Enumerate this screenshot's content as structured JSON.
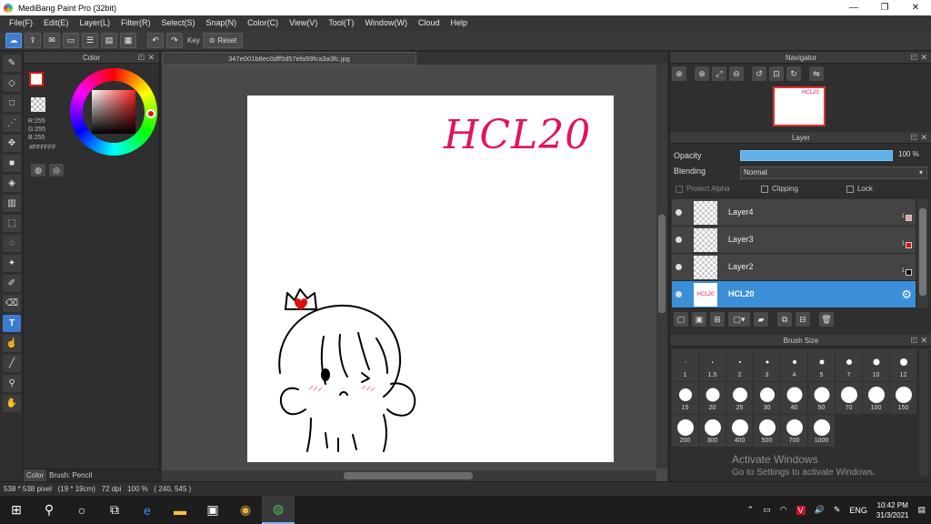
{
  "window": {
    "title": "MediBang Paint Pro (32bit)",
    "minimize": "—",
    "maximize": "❐",
    "close": "✕"
  },
  "menu": [
    "File(F)",
    "Edit(E)",
    "Layer(L)",
    "Filter(R)",
    "Select(S)",
    "Snap(N)",
    "Color(C)",
    "View(V)",
    "Tool(T)",
    "Window(W)",
    "Cloud",
    "Help"
  ],
  "toolbar": {
    "key_label": "Key",
    "reset_label": "Reset"
  },
  "color_panel": {
    "title": "Color",
    "rgb": "R:255\nG:255\nB:255",
    "hex": "#FFFFFF",
    "fg_color": "#ffffff",
    "tabs": {
      "color": "Color",
      "brush": "Brush: Pencil"
    }
  },
  "document": {
    "tab_title": "347e001b8ec0dff5d57efa59fca3a3fc.jpg",
    "canvas_text": "HCL20",
    "canvas_text_color": "#e4135a"
  },
  "navigator": {
    "title": "Navigator",
    "thumb_text": "HCL20"
  },
  "layer_panel": {
    "title": "Layer",
    "opacity_label": "Opacity",
    "opacity_value": "100 %",
    "opacity_fraction": 1.0,
    "blending_label": "Blending",
    "blending_value": "Normal",
    "protect_alpha": "Protect Alpha",
    "clipping": "Clipping",
    "lock": "Lock",
    "layers": [
      {
        "name": "Layer4",
        "count": "1",
        "color": "#f4a0a0"
      },
      {
        "name": "Layer3",
        "count": "1",
        "color": "#e01010"
      },
      {
        "name": "Layer2",
        "count": "1",
        "color": "#000000"
      },
      {
        "name": "HCL20",
        "thumb_text": "HCL20",
        "selected": true
      }
    ]
  },
  "brush_size": {
    "title": "Brush Size",
    "sizes": [
      "1",
      "1.5",
      "2",
      "3",
      "4",
      "5",
      "7",
      "10",
      "12",
      "15",
      "20",
      "25",
      "30",
      "40",
      "50",
      "70",
      "100",
      "150",
      "200",
      "300",
      "400",
      "500",
      "700",
      "1000"
    ]
  },
  "watermark": {
    "line1": "Activate Windows",
    "line2": "Go to Settings to activate Windows."
  },
  "status": {
    "text": "538 * 538 pixel   (19 * 19cm)   72 dpi   100 %   ( 240, 545 )"
  },
  "taskbar": {
    "language": "ENG",
    "time": "10:42 PM",
    "date": "31/3/2021"
  }
}
